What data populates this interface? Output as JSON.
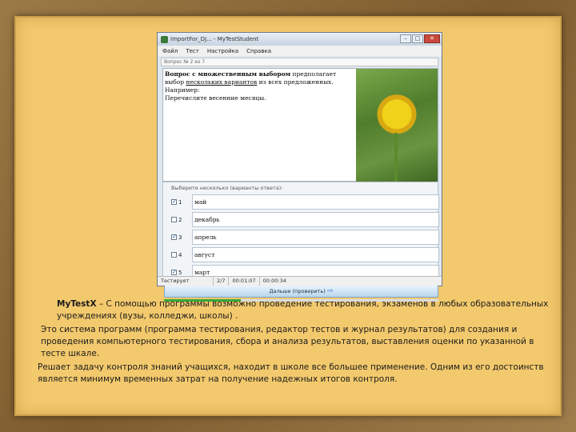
{
  "window": {
    "title": "ImportFor_DJ... - MyTestStudent",
    "controls": {
      "minimize": "–",
      "maximize": "□",
      "close": "✕"
    }
  },
  "menu": [
    "Файл",
    "Тест",
    "Настройка",
    "Справка"
  ],
  "question_number": "Вопрос № 2 из 7",
  "question": {
    "line1_bold_prefix": "Вопрос с множественным выбором",
    "line1_rest": " предполагает",
    "line2_pre": "выбор ",
    "line2_underlined": "нескольких вариантов",
    "line2_rest": " из всех предложенных.",
    "line3": "Например:",
    "line4": "Перечислите весенние месяцы."
  },
  "answers_legend": "Выберите несколько (варианты ответа):",
  "answers": [
    {
      "num": "1",
      "checked": true,
      "text": "май"
    },
    {
      "num": "2",
      "checked": false,
      "text": "декабрь"
    },
    {
      "num": "3",
      "checked": true,
      "text": "апрель"
    },
    {
      "num": "4",
      "checked": false,
      "text": "август"
    },
    {
      "num": "5",
      "checked": true,
      "text": "март"
    }
  ],
  "next_button": "Дальше (проверить)",
  "progress": 0.28,
  "status": {
    "mode": "Тестирует",
    "counter": "2/7",
    "time1": "00:01:07",
    "time2": "00:00:34"
  },
  "caption": {
    "p1_bold": "MyTestX",
    "p1_rest": " – С помощью программы возможно проведение тестирования, экзаменов в любых образовательных учреждениях (вузы, колледжи, школы) .",
    "p2": "Это система программ (программа тестирования, редактор тестов и журнал результатов) для создания и проведения компьютерного тестирования, сбора и анализа результатов, выставления оценки по указанной в тесте шкале.",
    "p3": "Решает задачу контроля знаний учащихся, находит в школе все большее применение. Одним из его достоинств является минимум временных затрат на получение надежных итогов контроля."
  }
}
